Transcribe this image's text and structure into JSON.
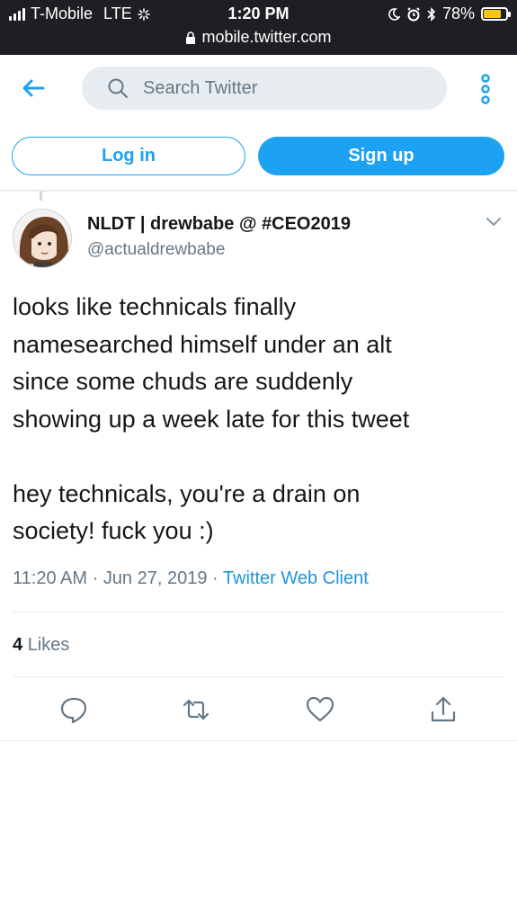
{
  "status_bar": {
    "carrier": "T-Mobile",
    "network": "LTE",
    "time": "1:20 PM",
    "battery": "78%",
    "battery_level": 0.78,
    "url": "mobile.twitter.com"
  },
  "header": {
    "search_placeholder": "Search Twitter",
    "icons": [
      "back-arrow-icon",
      "search-icon",
      "more-vertical-icon"
    ]
  },
  "auth": {
    "login_label": "Log in",
    "signup_label": "Sign up"
  },
  "tweet": {
    "display_name": "NLDT | drewbabe @ #CEO2019",
    "handle": "@actualdrewbabe",
    "text": "looks like technicals finally\nnamesearched himself under an alt\nsince some chuds are suddenly\nshowing up a week late for this tweet\n\nhey technicals, you're a drain on\nsociety! fuck you :)",
    "time": "11:20 AM",
    "date": "Jun 27, 2019",
    "client": "Twitter Web Client",
    "likes_count": "4",
    "likes_label": "Likes"
  },
  "colors": {
    "accent": "#1da1f2",
    "status_bar_bg": "#1e1f22",
    "secondary_text": "#657786",
    "battery": "#f5c518"
  }
}
